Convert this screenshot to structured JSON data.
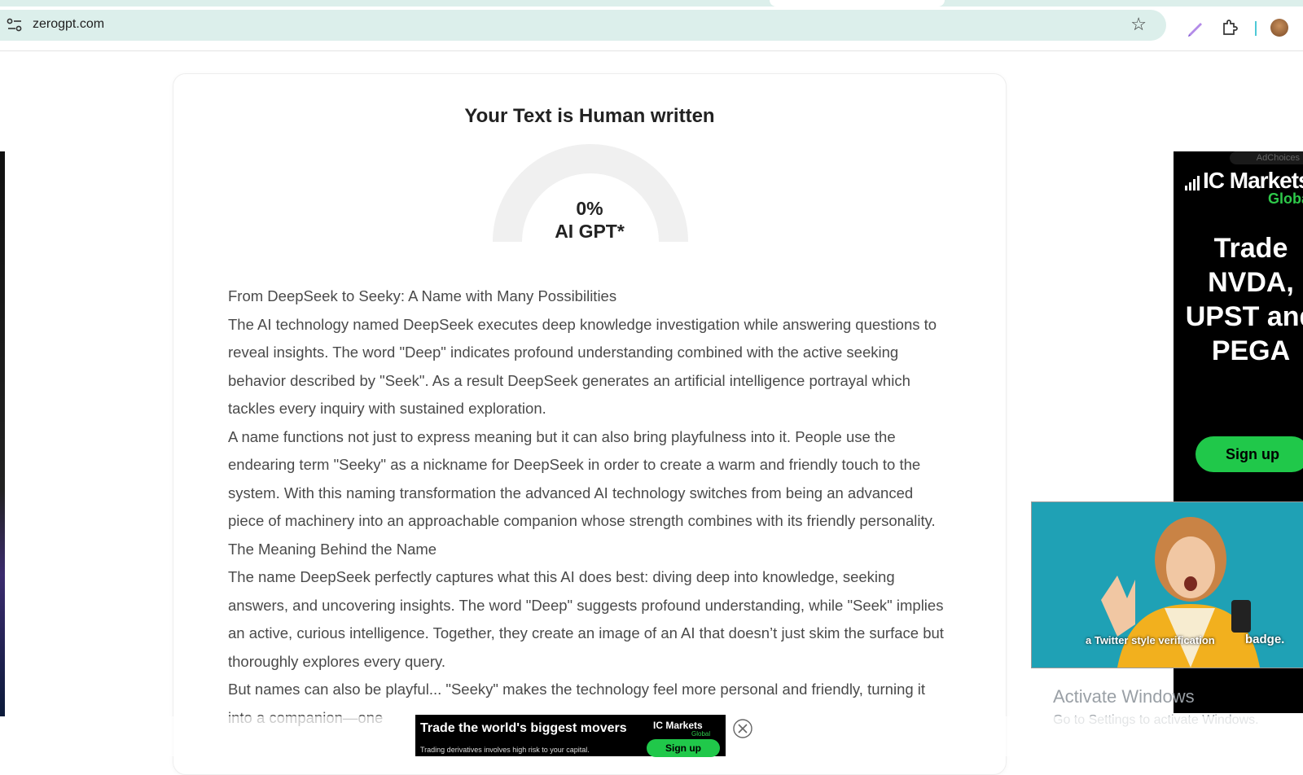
{
  "browser": {
    "url": "zerogpt.com",
    "icons": [
      "site-info-icon",
      "bookmark-star-icon",
      "pen-icon",
      "extensions-icon",
      "profile-avatar"
    ]
  },
  "result": {
    "title": "Your Text is Human written",
    "ai_percentage": "0%",
    "gauge_label": "AI GPT*",
    "gauge_fill_fraction": 0.0
  },
  "analyzed_text": {
    "paragraphs": [
      "From DeepSeek to Seeky: A Name with Many Possibilities",
      "The AI technology named DeepSeek executes deep knowledge investigation while answering questions to reveal insights. The word \"Deep\" indicates profound understanding combined with the active seeking behavior described by \"Seek\". As a result DeepSeek generates an artificial intelligence portrayal which tackles every inquiry with sustained exploration.",
      "A name functions not just to express meaning but it can also bring playfulness into it. People use the endearing term \"Seeky\" as a nickname for DeepSeek in order to create a warm and friendly touch to the system. With this naming transformation the advanced AI technology switches from being an advanced piece of machinery into an approachable companion whose strength combines with its friendly personality.",
      "The Meaning Behind the Name",
      "The name DeepSeek perfectly captures what this AI does best: diving deep into knowledge, seeking answers, and uncovering insights. The word \"Deep\" suggests profound understanding, while \"Seek\" implies an active, curious intelligence. Together, they create an image of an AI that doesn’t just skim the surface but thoroughly explores every query.",
      "But names can also be playful... \"Seeky\" makes the technology feel more personal and friendly, turning it into a companion—one"
    ]
  },
  "ads": {
    "right_banner": {
      "ad_choices": "AdChoices",
      "brand": "IC Markets",
      "brand_sub": "Global",
      "headline": "Trade NVDA, UPST and PEGA",
      "cta": "Sign up"
    },
    "video": {
      "caption": "a Twitter style verification",
      "caption_tail": "badge."
    },
    "bottom_banner": {
      "headline": "Trade the world's biggest movers",
      "disclaimer": "Trading derivatives involves high risk to your capital.",
      "brand": "IC Markets",
      "brand_sub": "Global",
      "cta": "Sign up"
    }
  },
  "os_watermark": {
    "title": "Activate Windows",
    "subtitle": "Go to Settings to activate Windows."
  },
  "colors": {
    "omnibox_bg": "#dcefeb",
    "ad_green": "#20c84a",
    "gauge_track": "#f0f0f0",
    "video_bg": "#1fa1b5"
  }
}
